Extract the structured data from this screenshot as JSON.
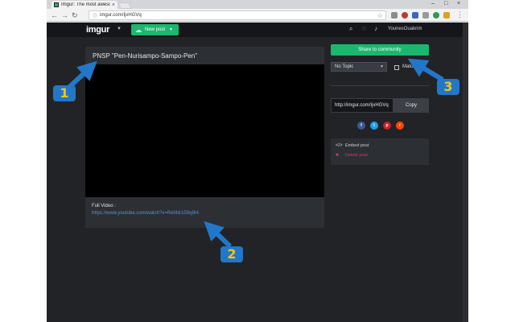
{
  "browser": {
    "tab_title": "Imgur: The most aweso",
    "tab_close": "×",
    "url": "imgur.com/IjxHGVq",
    "window_controls": {
      "minimize": "–",
      "maximize": "□",
      "close": "×"
    }
  },
  "header": {
    "logo": "imgur",
    "new_post_label": "New post",
    "username": "YounesOuakrim"
  },
  "post": {
    "title": "PNSP \"Pen-Nurisampo-Sampo-Pen\"",
    "description_label": "Full Video :",
    "description_link": "https://www.youtube.com/watch?v=RehNr159q9I4"
  },
  "sidebar": {
    "share_label": "Share to community",
    "topic_selected": "No Topic",
    "mature_label": "Mature",
    "share_link": "http://imgur.com/IjxHGVq",
    "copy_label": "Copy",
    "social": [
      {
        "name": "facebook",
        "glyph": "f",
        "color": "#3b5998"
      },
      {
        "name": "twitter",
        "glyph": "t",
        "color": "#1da1f2"
      },
      {
        "name": "pinterest",
        "glyph": "p",
        "color": "#cb2027"
      },
      {
        "name": "reddit",
        "glyph": "r",
        "color": "#ff4500"
      }
    ],
    "embed_label": "Embed post",
    "delete_label": "Delete post"
  },
  "markers": [
    {
      "label": "1"
    },
    {
      "label": "2"
    },
    {
      "label": "3"
    }
  ],
  "colors": {
    "brand_green": "#1bb76e",
    "page_bg": "#222326",
    "marker_blue": "#2277c9",
    "marker_digit": "#f5c518",
    "delete_pink": "#d4376d"
  }
}
